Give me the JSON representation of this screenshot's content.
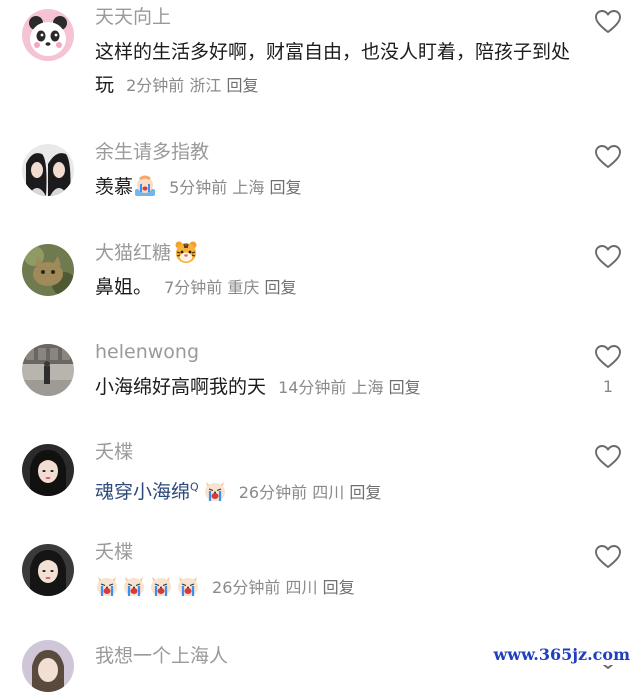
{
  "comments": [
    {
      "username": "天天向上",
      "text": "这样的生活多好啊，财富自由，也没人盯着，陪孩子到处玩",
      "time": "2分钟前",
      "location": "浙江",
      "reply_label": "回复",
      "avatar_icon": "panda-avatar-icon"
    },
    {
      "username": "余生请多指教",
      "text": "羡慕",
      "time": "5分钟前",
      "location": "上海",
      "reply_label": "回复",
      "emojis": [
        "crying-emoji-icon"
      ],
      "avatar_icon": "two-girls-avatar-icon"
    },
    {
      "username": "大猫红糖",
      "username_emoji": "tiger-face-icon",
      "text": "鼻姐。",
      "time": "7分钟前",
      "location": "重庆",
      "reply_label": "回复",
      "avatar_icon": "cat-avatar-icon"
    },
    {
      "username": "helenwong",
      "text": "小海绵好高啊我的天",
      "time": "14分钟前",
      "location": "上海",
      "reply_label": "回复",
      "like_count": "1",
      "avatar_icon": "street-photo-avatar-icon"
    },
    {
      "username": "夭楪",
      "mention": "魂穿小海绵",
      "mention_marker": "Q",
      "emojis": [
        "crying-dog-emoji-icon"
      ],
      "time": "26分钟前",
      "location": "四川",
      "reply_label": "回复",
      "avatar_icon": "girl-portrait-avatar-icon"
    },
    {
      "username": "夭楪",
      "emojis": [
        "crying-dog-emoji-icon",
        "crying-dog-emoji-icon",
        "crying-dog-emoji-icon",
        "crying-dog-emoji-icon"
      ],
      "time": "26分钟前",
      "location": "四川",
      "reply_label": "回复",
      "avatar_icon": "girl-portrait-avatar-icon"
    },
    {
      "username": "我想一个上海人",
      "avatar_icon": "girl-avatar-icon"
    }
  ],
  "watermark": "www.365jz.com",
  "colors": {
    "username": "#9a9a9a",
    "text": "#1c1c1c",
    "meta": "#8a8a8a",
    "mention": "#2c4a7a"
  }
}
